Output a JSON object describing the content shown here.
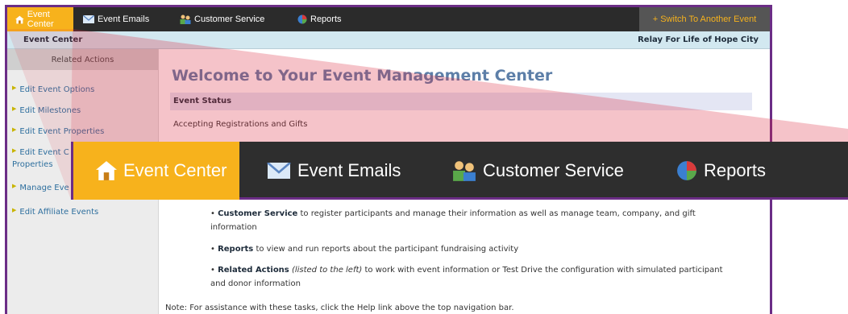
{
  "nav": {
    "items": [
      {
        "label": "Event Center",
        "icon": "home-icon",
        "active": true
      },
      {
        "label": "Event Emails",
        "icon": "envelope-icon"
      },
      {
        "label": "Customer Service",
        "icon": "people-icon"
      },
      {
        "label": "Reports",
        "icon": "pie-chart-icon"
      }
    ],
    "switch_label": "+ Switch To Another Event"
  },
  "subbar": {
    "left": "Event Center",
    "right": "Relay For Life of Hope City"
  },
  "sidebar": {
    "heading": "Related Actions",
    "items": [
      {
        "label": "Edit Event Options"
      },
      {
        "label": "Edit Milestones"
      },
      {
        "label": "Edit Event Properties"
      },
      {
        "label": "Edit Event C"
      },
      {
        "label": "Properties"
      },
      {
        "label": "Manage Eve"
      },
      {
        "label": "Edit Affiliate Events"
      }
    ]
  },
  "main": {
    "title": "Welcome to Your Event Management Center",
    "status_heading": "Event Status",
    "status_text": "Accepting Registrations and Gifts",
    "bullets": [
      {
        "bold": "Customer Service",
        "text": " to register participants and manage their information as well as manage team, company, and gift",
        "cont": "information"
      },
      {
        "bold": "Reports",
        "text": " to view and run reports about the participant fundraising activity"
      },
      {
        "bold": "Related Actions",
        "italic": " (listed to the left)",
        "text": " to work with event information or Test Drive the configuration with simulated participant",
        "cont": "and donor information"
      }
    ],
    "note": "Note: For assistance with these tasks, click the Help link above the top navigation bar."
  },
  "zoom": {
    "items": [
      {
        "label": "Event Center",
        "icon": "home-icon",
        "active": true
      },
      {
        "label": "Event Emails",
        "icon": "envelope-icon"
      },
      {
        "label": "Customer Service",
        "icon": "people-icon"
      },
      {
        "label": "Reports",
        "icon": "pie-chart-icon"
      }
    ]
  },
  "colors": {
    "nav_bg": "#2b2b2b",
    "active_tab": "#f7b21c",
    "frame_border": "#6b2d86",
    "title_blue": "#5d7fa8",
    "link_blue": "#2e6f9e"
  }
}
